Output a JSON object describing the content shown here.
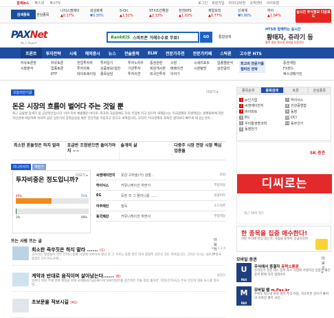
{
  "topnav": {
    "left": [
      "검색뉴스",
      "팍스넷",
      "팍스TV"
    ],
    "right": [
      "로그인",
      "회원가입",
      "아이디/비번",
      "고객센터",
      "사이트맵"
    ]
  },
  "ticker": {
    "badge": "검색종목",
    "sub": "관심종목",
    "items": [
      {
        "name": "나이스엠에이",
        "val": "▲0.17%",
        "down": false
      },
      {
        "name": "삼성화재",
        "val": "▼0.30%",
        "down": true
      },
      {
        "name": "S-Oil",
        "val": "▲1.31%",
        "down": false
      },
      {
        "name": "STX조선해양",
        "val": "▲2.13%",
        "down": false
      },
      {
        "name": "한전KPS",
        "val": "▲1.02%",
        "down": false
      },
      {
        "name": "제일모직",
        "val": "▲0.77%",
        "down": false
      },
      {
        "name": "신세계",
        "val": "▼0.90%",
        "down": true
      },
      {
        "name": "하이",
        "val": "▲1.04%",
        "down": false
      }
    ],
    "ad": "실시간 주식정보 다운로드"
  },
  "logo": {
    "main1": "PAX",
    "main2": "Net",
    "sub": "No.1 Report"
  },
  "search": {
    "brand": "BankKIS",
    "placeholder": "스마트폰 거래수수료 무료!",
    "button": "GO",
    "detail": "통합검색"
  },
  "hts_ad": {
    "line1": "HTS와 함께하는 실시간",
    "line2": "황태자, 쥬라기 등",
    "line3": "종목 정보 팍스넷 모바일 다운로드"
  },
  "gnb": [
    "프론트",
    "투자전략",
    "시세",
    "해외증시",
    "뉴스",
    "전술종목",
    "ELW",
    "전문가추천",
    "전문가카페",
    "스탁론",
    "고수분 HTS"
  ],
  "submenu": [
    {
      "lines": [
        "자유토론방",
        "시황분석"
      ]
    },
    {
      "lines": [
        "자유토론",
        "업종토론",
        "ETF"
      ]
    },
    {
      "lines": [
        "전업투자자",
        "투자의혹",
        "데이트레이딩"
      ]
    },
    {
      "lines": [
        "투자일기",
        "상품정보/일반",
        "종목상담"
      ]
    },
    {
      "lines": [
        "투자노하우",
        "기관투자",
        "투자의견"
      ]
    },
    {
      "lines": [
        "증권관련",
        "회원게시판",
        "외국인투자"
      ]
    },
    {
      "lines": [
        "시장",
        "매매의견",
        "이야기"
      ]
    },
    {
      "lines": [
        "시세리포트",
        "시장탐방"
      ]
    },
    {
      "lines": [
        "업종별분석",
        "상한글리"
      ]
    },
    {
      "lines": [
        "최고의 전문가를",
        "챔피언 전략"
      ],
      "highlight": true
    },
    {
      "lines": [
        "증권게임",
        "FX펀드",
        "팍스넷매거진"
      ]
    }
  ],
  "main": {
    "tag": "오늘의인기글",
    "more": "더보기 ▸",
    "headline": "돈은 시장의 흐름이 벌어다 주는 것일 뿐",
    "body": "최근 금융발 장세가 참 공감적인입니다. 이미 지속 배출했던 바닥로, 따고의 고용점에도 더욱 무겁위 치고 있으며 세계증시는 미국경제의 자생력있는 경제회복에 대한 자신감에 바탕하여 서서히 금년 상반기의 강력상승을 위한 전단역을 가동하고 있다고 보여집니다. 오다리 '미국경제의 회복은 생각보다 빠르게 대 있는것이...",
    "related": [
      "최소한 흔들짓은 하지 말라",
      "초급반 조정받으면 들어가야지 ~~",
      "솔개의 삶",
      "다중주 시장 전망 시장 핵심업종들"
    ],
    "tabs": [
      "미니리서치",
      "재발견",
      "토론 ▾"
    ],
    "poll": {
      "question": "투자비중은 정도입니까?",
      "p1": "49%",
      "p2": "51%",
      "p3": "1%",
      "p4": "99%",
      "more": "더보기 ▸"
    },
    "stocks": [
      {
        "c1": "씨앤에이전지",
        "c2": "옷감 고마울(가) 검찰..",
        "c3": "조회"
      },
      {
        "c1": "하이닉스",
        "c2": "커뮤니케이션 하면서",
        "c3": "부당하당"
      },
      {
        "c1": "EG",
        "c2": "득망 외 그 플러니를 ......",
        "c3": "임원이다"
      },
      {
        "c1": "아주레인",
        "c2": "질득",
        "c3": "소드의주"
      },
      {
        "c1": "동국제강",
        "c2": "커뮤니케이션 하면서",
        "c3": "부당하당"
      }
    ],
    "hot_title": "뜨는 사람 뜨는 글",
    "hot_more": "더보기 ▸",
    "hot": [
      {
        "title": "최소한 죽쑤짓은 하지 말라 ......",
        "count": "(1)",
        "desc": "고수라는 정병들이 전부 인터디 중환 시장에 이루어서 정선 문 그 흐르느 당할 알은 라서 정탈주 고분선 것도 지어입니다. 그러고 다시는 실수한 결국 종장도 2가 어느사에...",
        "date": "2011-2-4"
      },
      {
        "title": "계약과 반대로 움직이며 살아남는다......",
        "count": "(8)",
        "desc": "일본더 위탁 부채 경제 체질을 위해 국제통화기금(IMF)에 500억달러를 중은적은 전돌 중립 통하라. 지일(인지사고) 주요 인신과 대표 뉴스를 정으면...",
        "date": "놀랍다"
      },
      {
        "title": "초보문을 적보시길",
        "count": "(41)",
        "desc": "",
        "date": ""
      }
    ]
  },
  "right": {
    "tabs": [
      "종목순위",
      "총목검색",
      "토론",
      "관심종목"
    ],
    "rank_left": [
      "뉴인기업",
      "씨앤에이전지",
      "하이마트",
      "EG",
      "우리들생명과학",
      "동영전기"
    ],
    "rank_right": [
      "하이닉스",
      "건강증형잡",
      "동방",
      "OCI",
      "동부건기"
    ],
    "sk": {
      "logo": "SK 증권",
      "big": "디씨로는",
      "foot": "최근 30억 펀드"
    },
    "alert": {
      "title": "한 종목을 집중 매수한다!",
      "sub": "어떤 주식에 관심 있는지, 사람들 종목이 궁금하다면"
    },
    "mobile_title": "모바일 증권",
    "mobile_more": "더보기 ▸",
    "mobile": [
      {
        "ic": "U",
        "ic_sub": "PAX",
        "title": "주식에서 종결자",
        "title_red": "유락스증권",
        "desc": "유리인기 전문 데스 종목 투스 시장에 서명하신 집중권 좋은 종목 판매 지자 업데이트"
      },
      {
        "ic": "M",
        "ic_sub": "PAX",
        "title": "모바일 웹",
        "title_red": "m.Pax.kr",
        "desc": "폰에도 팍스넷 바로 열어 주식 이동, 자유토론 글쓰기 좋아의 모바일 웹이 국민..."
      }
    ]
  }
}
